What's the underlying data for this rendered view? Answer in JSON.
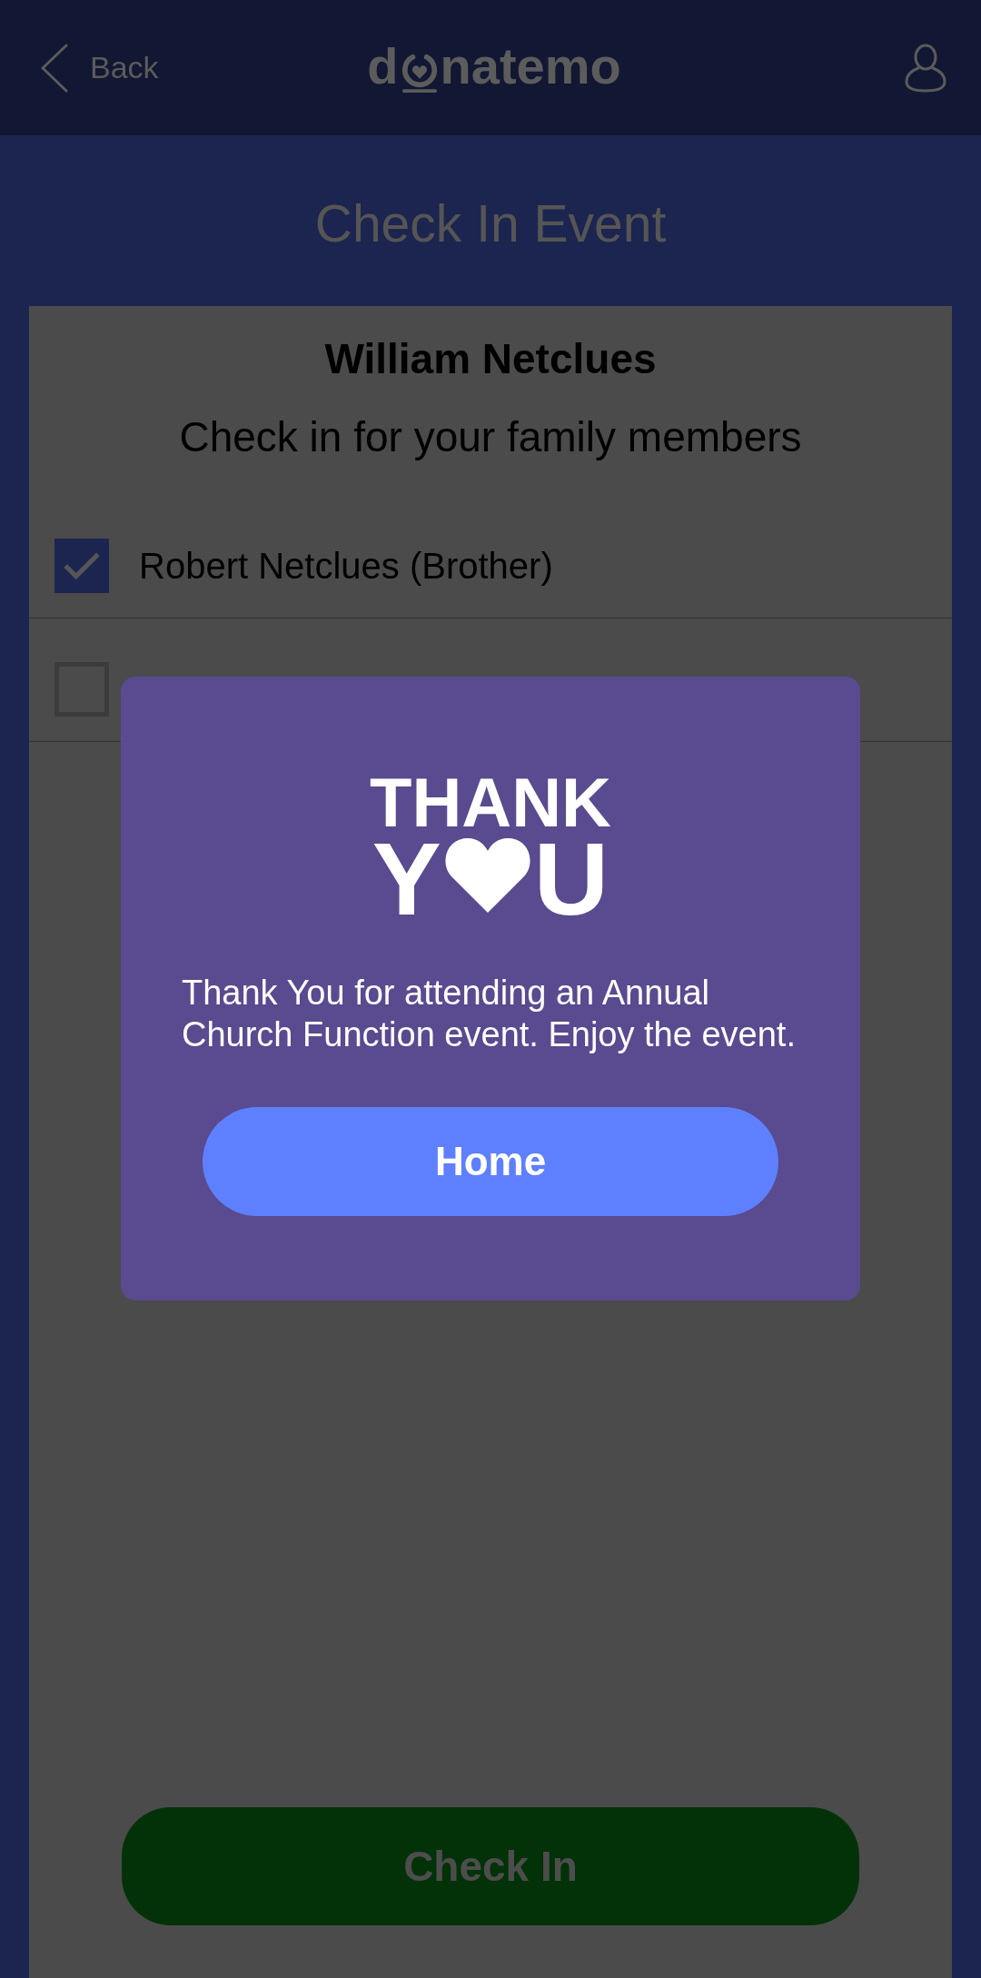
{
  "header": {
    "back_label": "Back",
    "logo": {
      "start": "d",
      "end": "natemo"
    }
  },
  "title": "Check In Event",
  "member": {
    "name": "William Netclues",
    "prompt": "Check in for your family members"
  },
  "family_members": [
    {
      "name": "Robert Netclues (Brother)",
      "checked": true
    },
    {
      "checked": false
    }
  ],
  "check_in_button": "Check In",
  "dialog": {
    "art": {
      "line_1": "THANK",
      "line_2_start": "Y",
      "line_2_end": "U"
    },
    "message": "Thank You for attending an Annual Church Function event. Enjoy the event.",
    "button": "Home"
  }
}
